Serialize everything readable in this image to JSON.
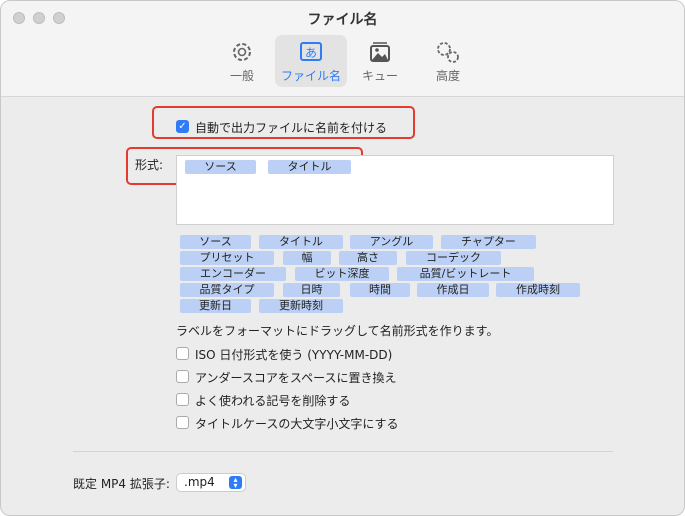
{
  "window": {
    "title": "ファイル名"
  },
  "toolbar": {
    "tabs": [
      {
        "label": "一般",
        "icon": "gear-icon"
      },
      {
        "label": "ファイル名",
        "icon": "text-a-icon"
      },
      {
        "label": "キュー",
        "icon": "photo-stack-icon"
      },
      {
        "label": "高度",
        "icon": "gears-icon"
      }
    ],
    "selected": "ファイル名"
  },
  "auto_name": {
    "label": "自動で出力ファイルに名前を付ける",
    "checked": true
  },
  "format": {
    "label": "形式:",
    "tokens": [
      "ソース",
      "タイトル"
    ]
  },
  "tags": [
    "ソース",
    "タイトル",
    "アングル",
    "チャプター",
    "プリセット",
    "幅",
    "高さ",
    "コーデック",
    "エンコーダー",
    "ビット深度",
    "品質/ビットレート",
    "品質タイプ",
    "日時",
    "時間",
    "作成日",
    "作成時刻",
    "更新日",
    "更新時刻"
  ],
  "hint": "ラベルをフォーマットにドラッグして名前形式を作ります。",
  "options": [
    {
      "label": "ISO 日付形式を使う (YYYY-MM-DD)",
      "checked": false
    },
    {
      "label": "アンダースコアをスペースに置き換え",
      "checked": false
    },
    {
      "label": "よく使われる記号を削除する",
      "checked": false
    },
    {
      "label": "タイトルケースの大文字小文字にする",
      "checked": false
    }
  ],
  "mp4": {
    "label": "既定 MP4 拡張子:",
    "value": ".mp4"
  },
  "colors": {
    "accent": "#2f7cf6",
    "tag": "#bcd0f5",
    "highlight": "#e33b2e"
  }
}
